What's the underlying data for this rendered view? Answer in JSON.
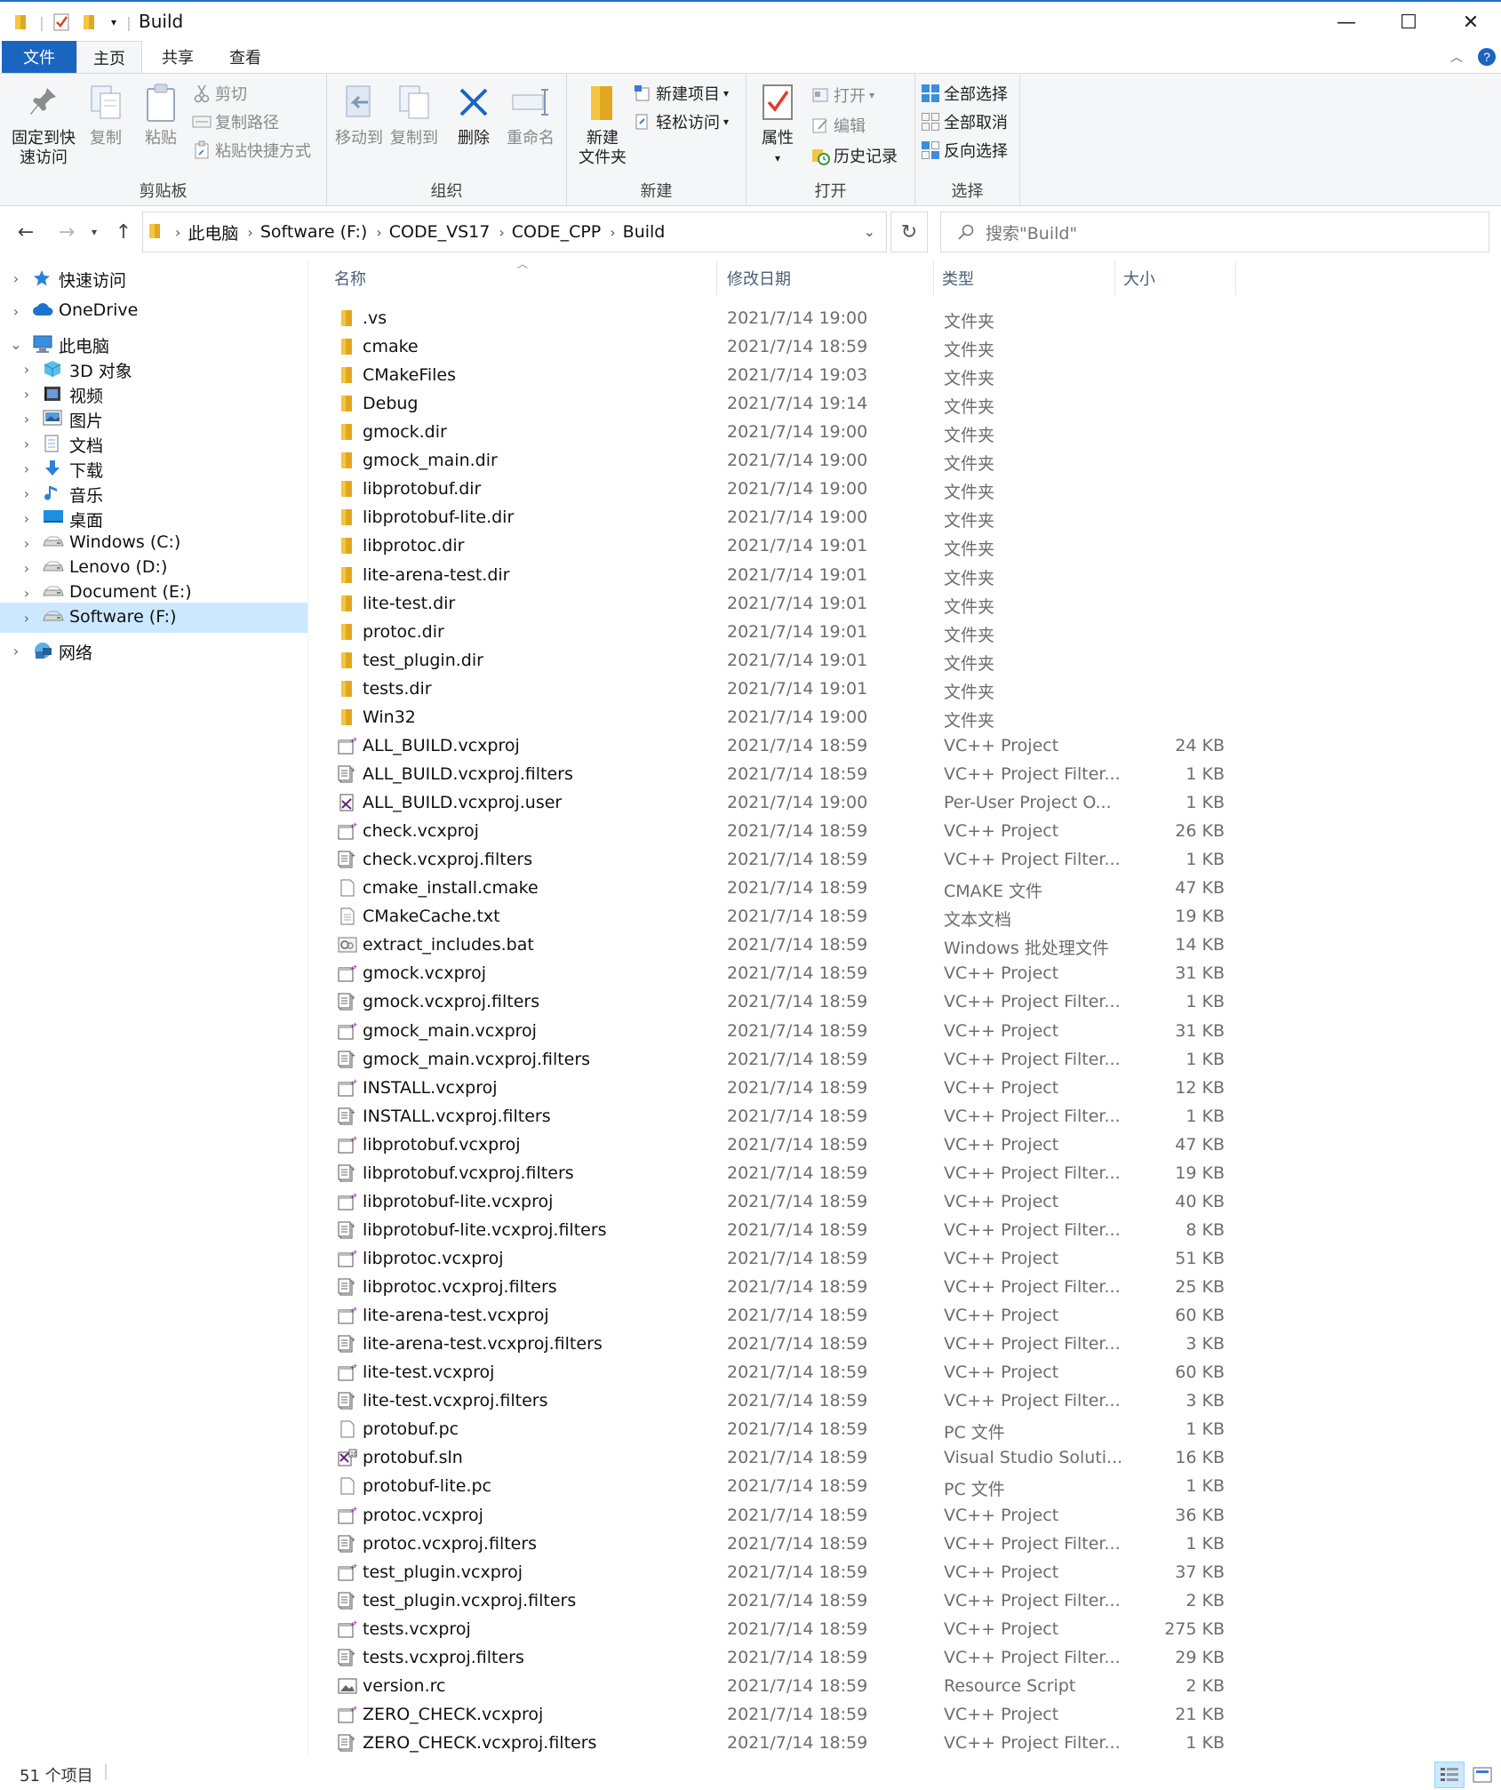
{
  "window": {
    "title": "Build",
    "minimize": "—",
    "maximize": "☐",
    "close": "✕"
  },
  "tabs": [
    "文件",
    "主页",
    "共享",
    "查看"
  ],
  "ribbon": {
    "clipboard": {
      "label": "剪贴板",
      "pin": "固定到快\n速访问",
      "copy": "复制",
      "paste": "粘贴",
      "cut": "剪切",
      "copy_path": "复制路径",
      "paste_shortcut": "粘贴快捷方式"
    },
    "organize": {
      "label": "组织",
      "move_to": "移动到",
      "copy_to": "复制到",
      "delete": "删除",
      "rename": "重命名"
    },
    "new": {
      "label": "新建",
      "new_folder": "新建\n文件夹",
      "new_item": "新建项目",
      "easy_access": "轻松访问"
    },
    "open": {
      "label": "打开",
      "properties": "属性",
      "open": "打开",
      "edit": "编辑",
      "history": "历史记录"
    },
    "select": {
      "label": "选择",
      "select_all": "全部选择",
      "select_none": "全部取消",
      "invert": "反向选择"
    }
  },
  "address": {
    "crumbs": [
      "此电脑",
      "Software (F:)",
      "CODE_VS17",
      "CODE_CPP",
      "Build"
    ],
    "search_placeholder": "搜索\"Build\""
  },
  "nav": [
    {
      "label": "快速访问",
      "level": 0,
      "icon": "star-icon"
    },
    {
      "label": "OneDrive",
      "level": 0,
      "icon": "cloud-icon"
    },
    {
      "label": "此电脑",
      "level": 0,
      "icon": "computer-icon",
      "expanded": true
    },
    {
      "label": "3D 对象",
      "level": 1,
      "icon": "cube-icon"
    },
    {
      "label": "视频",
      "level": 1,
      "icon": "video-icon"
    },
    {
      "label": "图片",
      "level": 1,
      "icon": "picture-icon"
    },
    {
      "label": "文档",
      "level": 1,
      "icon": "document-icon"
    },
    {
      "label": "下载",
      "level": 1,
      "icon": "download-icon"
    },
    {
      "label": "音乐",
      "level": 1,
      "icon": "music-icon"
    },
    {
      "label": "桌面",
      "level": 1,
      "icon": "desktop-icon"
    },
    {
      "label": "Windows (C:)",
      "level": 1,
      "icon": "drive-icon"
    },
    {
      "label": "Lenovo (D:)",
      "level": 1,
      "icon": "drive-icon"
    },
    {
      "label": "Document (E:)",
      "level": 1,
      "icon": "drive-icon"
    },
    {
      "label": "Software (F:)",
      "level": 1,
      "icon": "drive-icon",
      "selected": true
    },
    {
      "label": "网络",
      "level": 0,
      "icon": "network-icon"
    }
  ],
  "columns": {
    "name": "名称",
    "date": "修改日期",
    "type": "类型",
    "size": "大小"
  },
  "files": [
    {
      "name": ".vs",
      "date": "2021/7/14 19:00",
      "type": "文件夹",
      "size": "",
      "icon": "folder"
    },
    {
      "name": "cmake",
      "date": "2021/7/14 18:59",
      "type": "文件夹",
      "size": "",
      "icon": "folder"
    },
    {
      "name": "CMakeFiles",
      "date": "2021/7/14 19:03",
      "type": "文件夹",
      "size": "",
      "icon": "folder"
    },
    {
      "name": "Debug",
      "date": "2021/7/14 19:14",
      "type": "文件夹",
      "size": "",
      "icon": "folder"
    },
    {
      "name": "gmock.dir",
      "date": "2021/7/14 19:00",
      "type": "文件夹",
      "size": "",
      "icon": "folder"
    },
    {
      "name": "gmock_main.dir",
      "date": "2021/7/14 19:00",
      "type": "文件夹",
      "size": "",
      "icon": "folder"
    },
    {
      "name": "libprotobuf.dir",
      "date": "2021/7/14 19:00",
      "type": "文件夹",
      "size": "",
      "icon": "folder"
    },
    {
      "name": "libprotobuf-lite.dir",
      "date": "2021/7/14 19:00",
      "type": "文件夹",
      "size": "",
      "icon": "folder"
    },
    {
      "name": "libprotoc.dir",
      "date": "2021/7/14 19:01",
      "type": "文件夹",
      "size": "",
      "icon": "folder"
    },
    {
      "name": "lite-arena-test.dir",
      "date": "2021/7/14 19:01",
      "type": "文件夹",
      "size": "",
      "icon": "folder"
    },
    {
      "name": "lite-test.dir",
      "date": "2021/7/14 19:01",
      "type": "文件夹",
      "size": "",
      "icon": "folder"
    },
    {
      "name": "protoc.dir",
      "date": "2021/7/14 19:01",
      "type": "文件夹",
      "size": "",
      "icon": "folder"
    },
    {
      "name": "test_plugin.dir",
      "date": "2021/7/14 19:01",
      "type": "文件夹",
      "size": "",
      "icon": "folder"
    },
    {
      "name": "tests.dir",
      "date": "2021/7/14 19:01",
      "type": "文件夹",
      "size": "",
      "icon": "folder"
    },
    {
      "name": "Win32",
      "date": "2021/7/14 19:00",
      "type": "文件夹",
      "size": "",
      "icon": "folder"
    },
    {
      "name": "ALL_BUILD.vcxproj",
      "date": "2021/7/14 18:59",
      "type": "VC++ Project",
      "size": "24 KB",
      "icon": "vcxproj"
    },
    {
      "name": "ALL_BUILD.vcxproj.filters",
      "date": "2021/7/14 18:59",
      "type": "VC++ Project Filter...",
      "size": "1 KB",
      "icon": "filters"
    },
    {
      "name": "ALL_BUILD.vcxproj.user",
      "date": "2021/7/14 19:00",
      "type": "Per-User Project O...",
      "size": "1 KB",
      "icon": "user"
    },
    {
      "name": "check.vcxproj",
      "date": "2021/7/14 18:59",
      "type": "VC++ Project",
      "size": "26 KB",
      "icon": "vcxproj"
    },
    {
      "name": "check.vcxproj.filters",
      "date": "2021/7/14 18:59",
      "type": "VC++ Project Filter...",
      "size": "1 KB",
      "icon": "filters"
    },
    {
      "name": "cmake_install.cmake",
      "date": "2021/7/14 18:59",
      "type": "CMAKE 文件",
      "size": "47 KB",
      "icon": "blank"
    },
    {
      "name": "CMakeCache.txt",
      "date": "2021/7/14 18:59",
      "type": "文本文档",
      "size": "19 KB",
      "icon": "text"
    },
    {
      "name": "extract_includes.bat",
      "date": "2021/7/14 18:59",
      "type": "Windows 批处理文件",
      "size": "14 KB",
      "icon": "bat"
    },
    {
      "name": "gmock.vcxproj",
      "date": "2021/7/14 18:59",
      "type": "VC++ Project",
      "size": "31 KB",
      "icon": "vcxproj"
    },
    {
      "name": "gmock.vcxproj.filters",
      "date": "2021/7/14 18:59",
      "type": "VC++ Project Filter...",
      "size": "1 KB",
      "icon": "filters"
    },
    {
      "name": "gmock_main.vcxproj",
      "date": "2021/7/14 18:59",
      "type": "VC++ Project",
      "size": "31 KB",
      "icon": "vcxproj"
    },
    {
      "name": "gmock_main.vcxproj.filters",
      "date": "2021/7/14 18:59",
      "type": "VC++ Project Filter...",
      "size": "1 KB",
      "icon": "filters"
    },
    {
      "name": "INSTALL.vcxproj",
      "date": "2021/7/14 18:59",
      "type": "VC++ Project",
      "size": "12 KB",
      "icon": "vcxproj"
    },
    {
      "name": "INSTALL.vcxproj.filters",
      "date": "2021/7/14 18:59",
      "type": "VC++ Project Filter...",
      "size": "1 KB",
      "icon": "filters"
    },
    {
      "name": "libprotobuf.vcxproj",
      "date": "2021/7/14 18:59",
      "type": "VC++ Project",
      "size": "47 KB",
      "icon": "vcxproj"
    },
    {
      "name": "libprotobuf.vcxproj.filters",
      "date": "2021/7/14 18:59",
      "type": "VC++ Project Filter...",
      "size": "19 KB",
      "icon": "filters"
    },
    {
      "name": "libprotobuf-lite.vcxproj",
      "date": "2021/7/14 18:59",
      "type": "VC++ Project",
      "size": "40 KB",
      "icon": "vcxproj"
    },
    {
      "name": "libprotobuf-lite.vcxproj.filters",
      "date": "2021/7/14 18:59",
      "type": "VC++ Project Filter...",
      "size": "8 KB",
      "icon": "filters"
    },
    {
      "name": "libprotoc.vcxproj",
      "date": "2021/7/14 18:59",
      "type": "VC++ Project",
      "size": "51 KB",
      "icon": "vcxproj"
    },
    {
      "name": "libprotoc.vcxproj.filters",
      "date": "2021/7/14 18:59",
      "type": "VC++ Project Filter...",
      "size": "25 KB",
      "icon": "filters"
    },
    {
      "name": "lite-arena-test.vcxproj",
      "date": "2021/7/14 18:59",
      "type": "VC++ Project",
      "size": "60 KB",
      "icon": "vcxproj"
    },
    {
      "name": "lite-arena-test.vcxproj.filters",
      "date": "2021/7/14 18:59",
      "type": "VC++ Project Filter...",
      "size": "3 KB",
      "icon": "filters"
    },
    {
      "name": "lite-test.vcxproj",
      "date": "2021/7/14 18:59",
      "type": "VC++ Project",
      "size": "60 KB",
      "icon": "vcxproj"
    },
    {
      "name": "lite-test.vcxproj.filters",
      "date": "2021/7/14 18:59",
      "type": "VC++ Project Filter...",
      "size": "3 KB",
      "icon": "filters"
    },
    {
      "name": "protobuf.pc",
      "date": "2021/7/14 18:59",
      "type": "PC 文件",
      "size": "1 KB",
      "icon": "blank"
    },
    {
      "name": "protobuf.sln",
      "date": "2021/7/14 18:59",
      "type": "Visual Studio Soluti...",
      "size": "16 KB",
      "icon": "sln"
    },
    {
      "name": "protobuf-lite.pc",
      "date": "2021/7/14 18:59",
      "type": "PC 文件",
      "size": "1 KB",
      "icon": "blank"
    },
    {
      "name": "protoc.vcxproj",
      "date": "2021/7/14 18:59",
      "type": "VC++ Project",
      "size": "36 KB",
      "icon": "vcxproj"
    },
    {
      "name": "protoc.vcxproj.filters",
      "date": "2021/7/14 18:59",
      "type": "VC++ Project Filter...",
      "size": "1 KB",
      "icon": "filters"
    },
    {
      "name": "test_plugin.vcxproj",
      "date": "2021/7/14 18:59",
      "type": "VC++ Project",
      "size": "37 KB",
      "icon": "vcxproj"
    },
    {
      "name": "test_plugin.vcxproj.filters",
      "date": "2021/7/14 18:59",
      "type": "VC++ Project Filter...",
      "size": "2 KB",
      "icon": "filters"
    },
    {
      "name": "tests.vcxproj",
      "date": "2021/7/14 18:59",
      "type": "VC++ Project",
      "size": "275 KB",
      "icon": "vcxproj"
    },
    {
      "name": "tests.vcxproj.filters",
      "date": "2021/7/14 18:59",
      "type": "VC++ Project Filter...",
      "size": "29 KB",
      "icon": "filters"
    },
    {
      "name": "version.rc",
      "date": "2021/7/14 18:59",
      "type": "Resource Script",
      "size": "2 KB",
      "icon": "rc"
    },
    {
      "name": "ZERO_CHECK.vcxproj",
      "date": "2021/7/14 18:59",
      "type": "VC++ Project",
      "size": "21 KB",
      "icon": "vcxproj"
    },
    {
      "name": "ZERO_CHECK.vcxproj.filters",
      "date": "2021/7/14 18:59",
      "type": "VC++ Project Filter...",
      "size": "1 KB",
      "icon": "filters"
    }
  ],
  "status": {
    "count": "51 个项目"
  },
  "colors": {
    "accent": "#1a65c0",
    "selection": "#cce8ff",
    "folder": "#f5c542"
  }
}
